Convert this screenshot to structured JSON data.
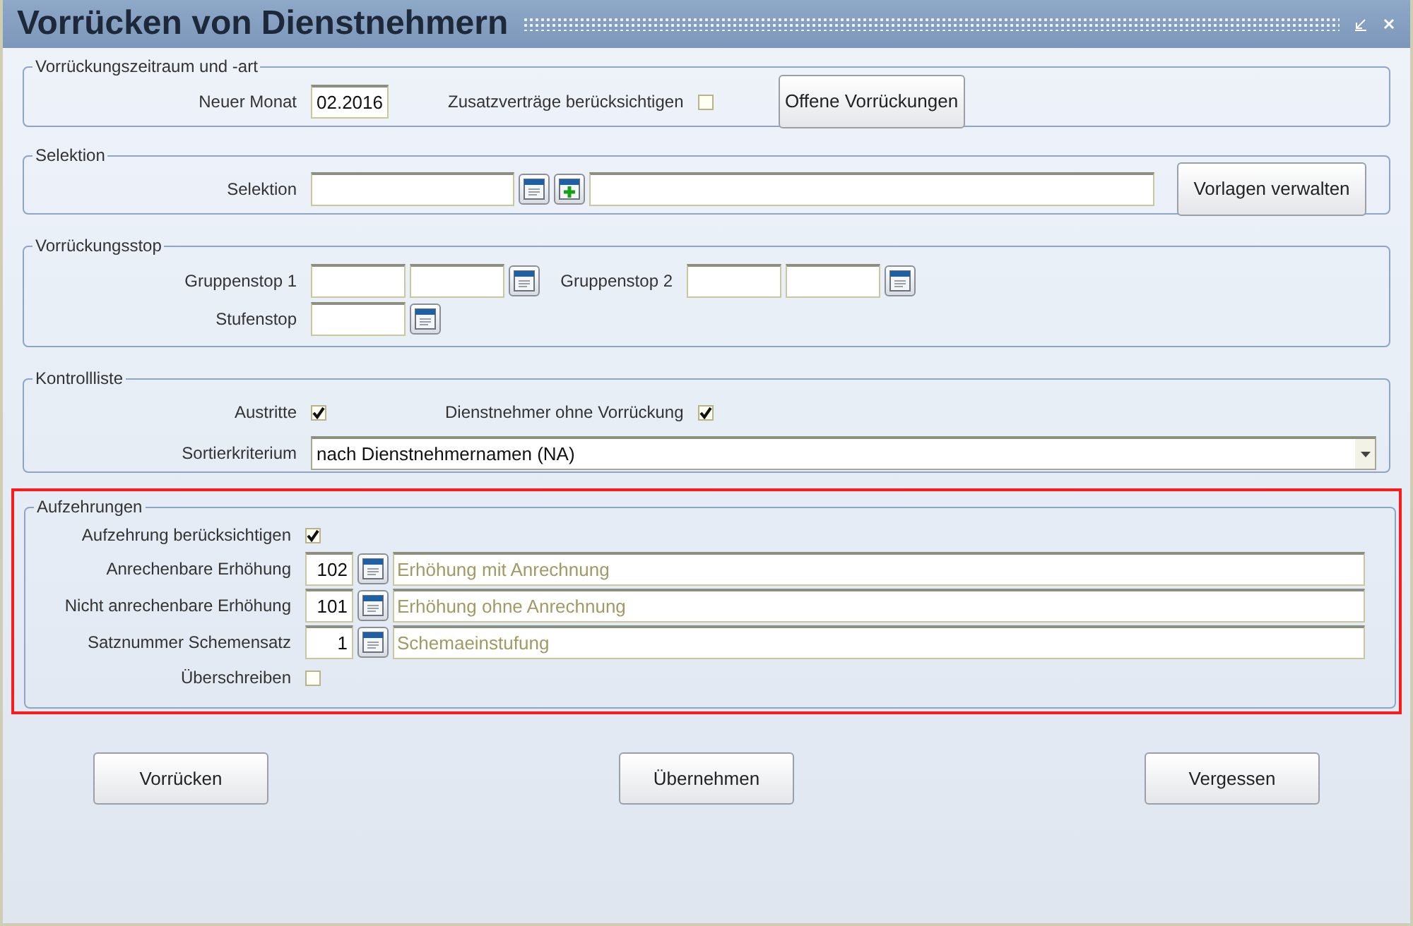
{
  "window": {
    "title": "Vorrücken von Dienstnehmern"
  },
  "period": {
    "legend": "Vorrückungszeitraum und -art",
    "month_label": "Neuer Monat",
    "month_value": "02.2016",
    "extra_label": "Zusatzverträge berücksichtigen",
    "extra_checked": false,
    "button": "Offene Vorrückungen"
  },
  "selection": {
    "legend": "Selektion",
    "label": "Selektion",
    "button": "Vorlagen verwalten"
  },
  "stop": {
    "legend": "Vorrückungsstop",
    "group1_label": "Gruppenstop 1",
    "group2_label": "Gruppenstop 2",
    "step_label": "Stufenstop"
  },
  "control": {
    "legend": "Kontrollliste",
    "exits_label": "Austritte",
    "exits_checked": true,
    "without_label": "Dienstnehmer ohne Vorrückung",
    "without_checked": true,
    "sort_label": "Sortierkriterium",
    "sort_value": "nach Dienstnehmernamen (NA)"
  },
  "consumption": {
    "legend": "Aufzehrungen",
    "highlighted": true,
    "consider_label": "Aufzehrung berücksichtigen",
    "consider_checked": true,
    "rows": [
      {
        "label": "Anrechenbare Erhöhung",
        "code": "102",
        "text": "Erhöhung mit Anrechnung"
      },
      {
        "label": "Nicht anrechenbare Erhöhung",
        "code": "101",
        "text": "Erhöhung ohne Anrechnung"
      },
      {
        "label": "Satznummer Schemensatz",
        "code": "1",
        "text": "Schemaeinstufung"
      }
    ],
    "overwrite_label": "Überschreiben",
    "overwrite_checked": false
  },
  "buttons": [
    "Vorrücken",
    "Übernehmen",
    "Vergessen"
  ]
}
